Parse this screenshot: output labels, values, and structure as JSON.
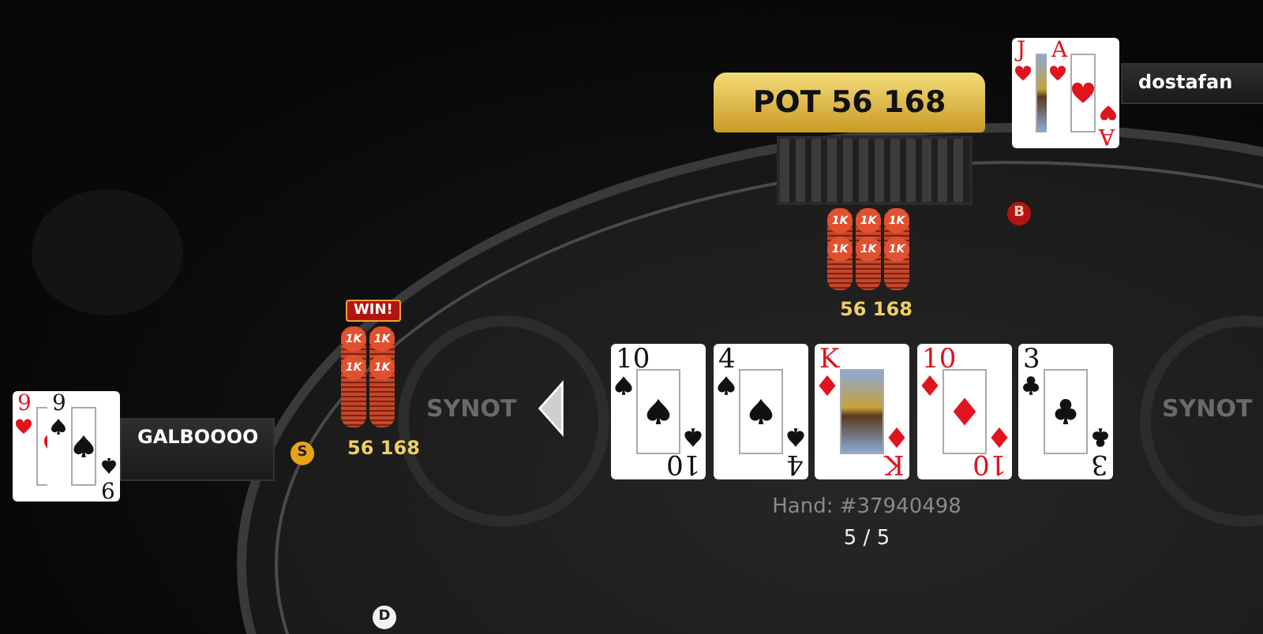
{
  "pot": {
    "label": "POT 56 168",
    "amount": "56 168",
    "chip_stacks": [
      {
        "labels": [
          "1K",
          "1K"
        ]
      },
      {
        "labels": [
          "1K",
          "1K"
        ]
      },
      {
        "labels": [
          "1K",
          "1K"
        ]
      }
    ]
  },
  "table_logos": [
    "SYNOT",
    "SYNOT"
  ],
  "players": [
    {
      "name": "dostafan",
      "cards": [
        {
          "ranks": [
            "J"
          ],
          "suit": {
            "kind": "hearts"
          },
          "kind": "face"
        },
        {
          "ranks": [
            "A",
            "A"
          ],
          "suit": {
            "kind": "hearts"
          },
          "kind": "number"
        }
      ]
    },
    {
      "name": "GALBOOOO",
      "winner": true,
      "win_badge": "WIN!",
      "amount": "56 168",
      "chip_stacks": [
        {
          "labels": [
            "1K",
            "1K"
          ]
        },
        {
          "labels": [
            "1K",
            "1K"
          ]
        }
      ],
      "cards": [
        {
          "ranks": [
            "9"
          ],
          "suit": {
            "kind": "hearts"
          },
          "kind": "number"
        },
        {
          "ranks": [
            "9",
            "9"
          ],
          "suit": {
            "kind": "spades"
          },
          "kind": "number"
        }
      ]
    }
  ],
  "markers": [
    {
      "label": "B",
      "color": "#b3140f"
    },
    {
      "label": "S",
      "color": "#e8a317"
    },
    {
      "label": "D",
      "color": "#f2f2f2"
    }
  ],
  "board": [
    {
      "ranks": [
        "10",
        "10"
      ],
      "suit": {
        "kind": "spades"
      },
      "kind": "number"
    },
    {
      "ranks": [
        "4",
        "4"
      ],
      "suit": {
        "kind": "spades"
      },
      "kind": "number"
    },
    {
      "ranks": [
        "K",
        "K"
      ],
      "suit": {
        "kind": "diamonds"
      },
      "kind": "face"
    },
    {
      "ranks": [
        "10",
        "10"
      ],
      "suit": {
        "kind": "diamonds"
      },
      "kind": "number"
    },
    {
      "ranks": [
        "3",
        "3"
      ],
      "suit": {
        "kind": "clubs"
      },
      "kind": "number"
    }
  ],
  "hand_label": "Hand: #37940498",
  "replay_position": "5 / 5"
}
